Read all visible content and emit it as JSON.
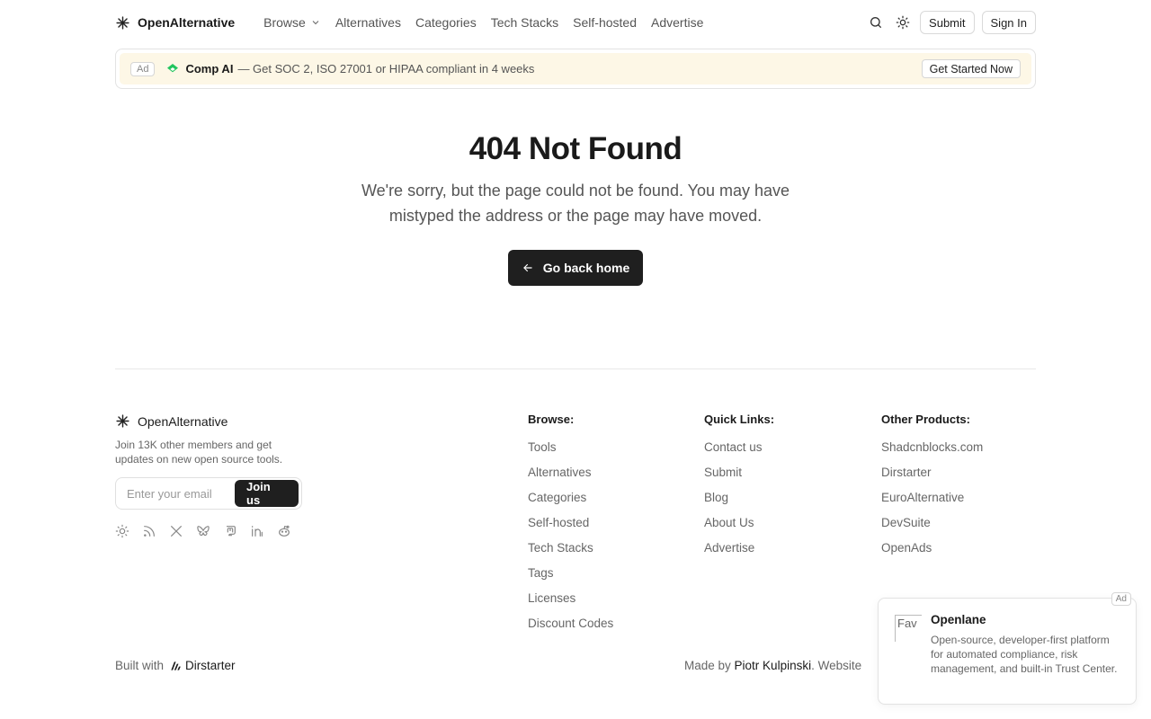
{
  "header": {
    "brand": "OpenAlternative",
    "nav": [
      {
        "label": "Browse",
        "has_dropdown": true
      },
      {
        "label": "Alternatives"
      },
      {
        "label": "Categories"
      },
      {
        "label": "Tech Stacks"
      },
      {
        "label": "Self-hosted"
      },
      {
        "label": "Advertise"
      }
    ],
    "icons": [
      "search-icon",
      "sun-icon"
    ],
    "submit_label": "Submit",
    "signin_label": "Sign In"
  },
  "ad_banner": {
    "tag": "Ad",
    "name": "Comp AI",
    "text": "— Get SOC 2, ISO 27001 or HIPAA compliant in 4 weeks",
    "cta": "Get Started Now",
    "accent": "#22c55e"
  },
  "main": {
    "title": "404 Not Found",
    "subtitle": "We're sorry, but the page could not be found. You may have mistyped the address or the page may have moved.",
    "home_button": "Go back home"
  },
  "footer": {
    "brand": "OpenAlternative",
    "blurb": "Join 13K other members and get updates on new open source tools.",
    "newsletter": {
      "placeholder": "Enter your email",
      "button": "Join us"
    },
    "socials": [
      "sun-icon",
      "rss-icon",
      "x-icon",
      "bluesky-icon",
      "mastodon-icon",
      "linkedin-icon",
      "reddit-icon"
    ],
    "columns": [
      {
        "title": "Browse:",
        "links": [
          "Tools",
          "Alternatives",
          "Categories",
          "Self-hosted",
          "Tech Stacks",
          "Tags",
          "Licenses",
          "Discount Codes"
        ]
      },
      {
        "title": "Quick Links:",
        "links": [
          "Contact us",
          "Submit",
          "Blog",
          "About Us",
          "Advertise"
        ]
      },
      {
        "title": "Other Products:",
        "links": [
          "Shadcnblocks.com",
          "Dirstarter",
          "EuroAlternative",
          "DevSuite",
          "OpenAds"
        ]
      }
    ],
    "built_with": "Built with",
    "built_with_name": "Dirstarter",
    "made_by_prefix": "Made by",
    "made_by_name": "Piotr Kulpinski",
    "made_by_suffix": ". Website"
  },
  "float_ad": {
    "tag": "Ad",
    "img_alt": "Fav",
    "name": "Openlane",
    "description": "Open-source, developer-first platform for automated compliance, risk management, and built-in Trust Center."
  }
}
